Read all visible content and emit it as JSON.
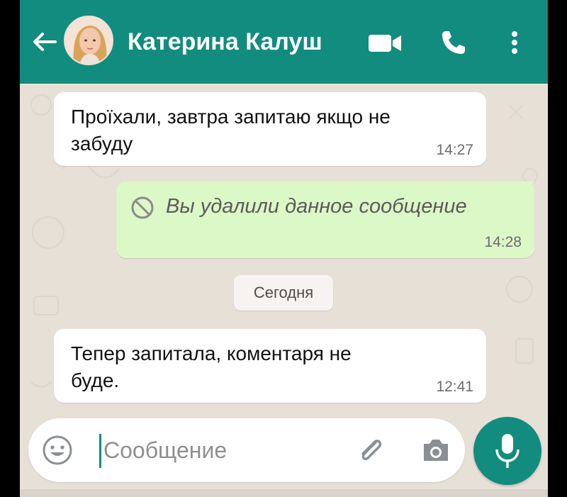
{
  "header": {
    "contact_name": "Катерина Калуш",
    "bg_color": "#128c7e",
    "icons": [
      "back-arrow-icon",
      "video-call-icon",
      "voice-call-icon",
      "more-options-icon"
    ]
  },
  "messages": [
    {
      "direction": "incoming",
      "text_line1": "Проїхали, завтра запитаю якщо не",
      "text_line2": "забуду",
      "time": "14:27"
    },
    {
      "direction": "outgoing",
      "deleted": true,
      "text": "Вы удалили данное сообщение",
      "time": "14:28"
    },
    {
      "direction": "incoming",
      "text_line1": "Тепер запитала, коментаря не",
      "text_line2": "буде.",
      "time": "12:41"
    }
  ],
  "date_divider": "Сегодня",
  "composer": {
    "placeholder": "Сообщение",
    "icons": [
      "emoji-icon",
      "attach-icon",
      "camera-icon",
      "mic-icon"
    ]
  },
  "colors": {
    "incoming_bubble": "#ffffff",
    "outgoing_bubble": "#dcf8c6",
    "wallpaper": "#e7e0d7",
    "accent": "#128c7e"
  }
}
